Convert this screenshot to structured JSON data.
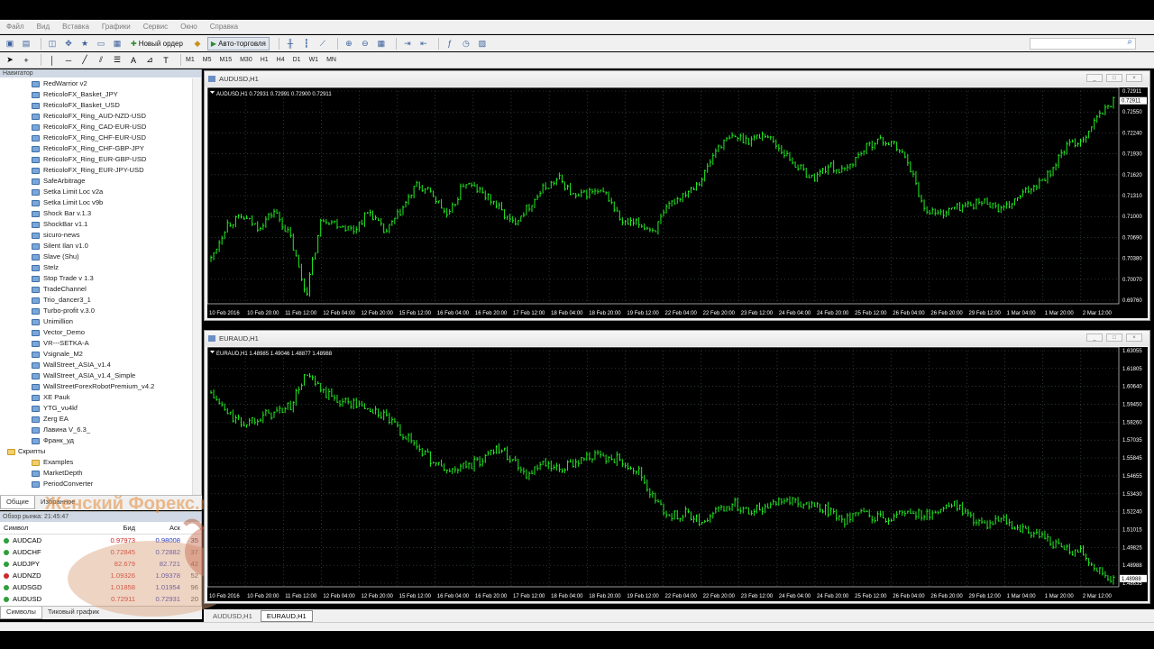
{
  "menu": [
    "Файл",
    "Вид",
    "Вставка",
    "Графики",
    "Сервис",
    "Окно",
    "Справка"
  ],
  "toolbar": {
    "new_order": "Новый ордер",
    "autotrade": "Авто-торговля",
    "timeframes": [
      "M1",
      "M5",
      "M15",
      "M30",
      "H1",
      "H4",
      "D1",
      "W1",
      "MN"
    ]
  },
  "navigator": {
    "title": "Навигатор",
    "items": [
      "RedWarrior v2",
      "ReticoloFX_Basket_JPY",
      "ReticoloFX_Basket_USD",
      "ReticoloFX_Ring_AUD-NZD-USD",
      "ReticoloFX_Ring_CAD-EUR-USD",
      "ReticoloFX_Ring_CHF-EUR-USD",
      "ReticoloFX_Ring_CHF-GBP-JPY",
      "ReticoloFX_Ring_EUR-GBP-USD",
      "ReticoloFX_Ring_EUR-JPY-USD",
      "SafeArbitrage",
      "Setka Limit Loc v2a",
      "Setka Limit Loc v9b",
      "Shock Bar v.1.3",
      "ShockBar v1.1",
      "sicuro-news",
      "Silent Ilan v1.0",
      "Slave (Shu)",
      "Stelz",
      "Stop Trade v 1.3",
      "TradeChannel",
      "Trio_dancer3_1",
      "Turbo-profit v.3.0",
      "Unimillion",
      "Vector_Demo",
      "VR---SETKA-A",
      "Vsignale_M2",
      "WallStreet_ASIA_v1.4",
      "WallStreet_ASIA_v1.4_Simple",
      "WallStreetForexRobotPremium_v4.2",
      "XE Pauk",
      "YTG_vu4kf",
      "Zerg EA",
      "Лавина V_6.3_",
      "Франк_уд"
    ],
    "scripts_label": "Скрипты",
    "script_items": [
      "Examples",
      "MarketDepth",
      "PeriodConverter"
    ],
    "tabs": [
      "Общие",
      "Избранное"
    ]
  },
  "market": {
    "title": "Обзор рынка: 21:45:47",
    "headers": [
      "Символ",
      "Бид",
      "Аск",
      ""
    ],
    "rows": [
      {
        "s": "AUDCAD",
        "bid": "0.97973",
        "ask": "0.98008",
        "sp": "35",
        "dir": "up"
      },
      {
        "s": "AUDCHF",
        "bid": "0.72845",
        "ask": "0.72882",
        "sp": "37",
        "dir": "up"
      },
      {
        "s": "AUDJPY",
        "bid": "82.679",
        "ask": "82.721",
        "sp": "42",
        "dir": "up"
      },
      {
        "s": "AUDNZD",
        "bid": "1.09326",
        "ask": "1.09378",
        "sp": "52",
        "dir": "dn"
      },
      {
        "s": "AUDSGD",
        "bid": "1.01858",
        "ask": "1.01954",
        "sp": "96",
        "dir": "up"
      },
      {
        "s": "AUDUSD",
        "bid": "0.72911",
        "ask": "0.72931",
        "sp": "20",
        "dir": "up"
      }
    ],
    "tabs": [
      "Символы",
      "Тиковый график"
    ]
  },
  "watermark": "Женский Форекс.ru",
  "charts": [
    {
      "window_title": "AUDUSD,H1",
      "info": "AUDUSD,H1  0.72931 0.72991 0.72900 0.72911",
      "ymin": 0.6976,
      "ymax": 0.7306,
      "yticks": [
        "0.72911",
        "0.72550",
        "0.72240",
        "0.71930",
        "0.71620",
        "0.71310",
        "0.71000",
        "0.70690",
        "0.70380",
        "0.70070",
        "0.69760"
      ],
      "xticks": [
        "10 Feb 2016",
        "10 Feb 20:00",
        "11 Feb 12:00",
        "12 Feb 04:00",
        "12 Feb 20:00",
        "15 Feb 12:00",
        "16 Feb 04:00",
        "16 Feb 20:00",
        "17 Feb 12:00",
        "18 Feb 04:00",
        "18 Feb 20:00",
        "19 Feb 12:00",
        "22 Feb 04:00",
        "22 Feb 20:00",
        "23 Feb 12:00",
        "24 Feb 04:00",
        "24 Feb 20:00",
        "25 Feb 12:00",
        "26 Feb 04:00",
        "26 Feb 20:00",
        "29 Feb 12:00",
        "1 Mar 04:00",
        "1 Mar 20:00",
        "2 Mar 12:00"
      ],
      "close": [
        0.7045,
        0.71,
        0.711,
        0.7095,
        0.712,
        0.708,
        0.699,
        0.711,
        0.71,
        0.709,
        0.712,
        0.7085,
        0.712,
        0.716,
        0.7145,
        0.711,
        0.7165,
        0.715,
        0.713,
        0.71,
        0.7125,
        0.7155,
        0.717,
        0.714,
        0.715,
        0.7145,
        0.71,
        0.71,
        0.709,
        0.713,
        0.715,
        0.717,
        0.722,
        0.7235,
        0.723,
        0.724,
        0.7215,
        0.719,
        0.717,
        0.719,
        0.718,
        0.721,
        0.723,
        0.7225,
        0.72,
        0.7125,
        0.7115,
        0.7125,
        0.713,
        0.7135,
        0.712,
        0.714,
        0.716,
        0.718,
        0.722,
        0.723,
        0.7265,
        0.7291
      ]
    },
    {
      "window_title": "EURAUD,H1",
      "info": "EURAUD,H1  1.48985 1.49046 1.48877 1.48988",
      "ymin": 1.4848,
      "ymax": 1.6305,
      "yticks": [
        "1.63055",
        "1.61805",
        "1.60640",
        "1.59450",
        "1.58260",
        "1.57035",
        "1.55845",
        "1.54655",
        "1.53430",
        "1.52240",
        "1.51015",
        "1.49825",
        "1.48988",
        "1.48635"
      ],
      "xticks": [
        "10 Feb 2016",
        "10 Feb 20:00",
        "11 Feb 12:00",
        "12 Feb 04:00",
        "12 Feb 20:00",
        "15 Feb 12:00",
        "16 Feb 04:00",
        "16 Feb 20:00",
        "17 Feb 12:00",
        "18 Feb 04:00",
        "18 Feb 20:00",
        "19 Feb 12:00",
        "22 Feb 04:00",
        "22 Feb 20:00",
        "23 Feb 12:00",
        "24 Feb 04:00",
        "24 Feb 20:00",
        "25 Feb 12:00",
        "26 Feb 04:00",
        "26 Feb 20:00",
        "29 Feb 12:00",
        "1 Mar 04:00",
        "1 Mar 20:00",
        "2 Mar 12:00"
      ],
      "close": [
        1.604,
        1.592,
        1.585,
        1.59,
        1.592,
        1.596,
        1.616,
        1.605,
        1.6,
        1.598,
        1.594,
        1.59,
        1.58,
        1.572,
        1.562,
        1.556,
        1.559,
        1.562,
        1.572,
        1.564,
        1.554,
        1.56,
        1.556,
        1.562,
        1.566,
        1.564,
        1.563,
        1.556,
        1.538,
        1.528,
        1.53,
        1.525,
        1.532,
        1.536,
        1.532,
        1.534,
        1.54,
        1.537,
        1.534,
        1.532,
        1.526,
        1.529,
        1.528,
        1.527,
        1.532,
        1.528,
        1.533,
        1.535,
        1.528,
        1.522,
        1.526,
        1.52,
        1.518,
        1.513,
        1.508,
        1.506,
        1.495,
        1.4899
      ]
    }
  ],
  "window_tabs": [
    "AUDUSD,H1",
    "EURAUD,H1"
  ]
}
